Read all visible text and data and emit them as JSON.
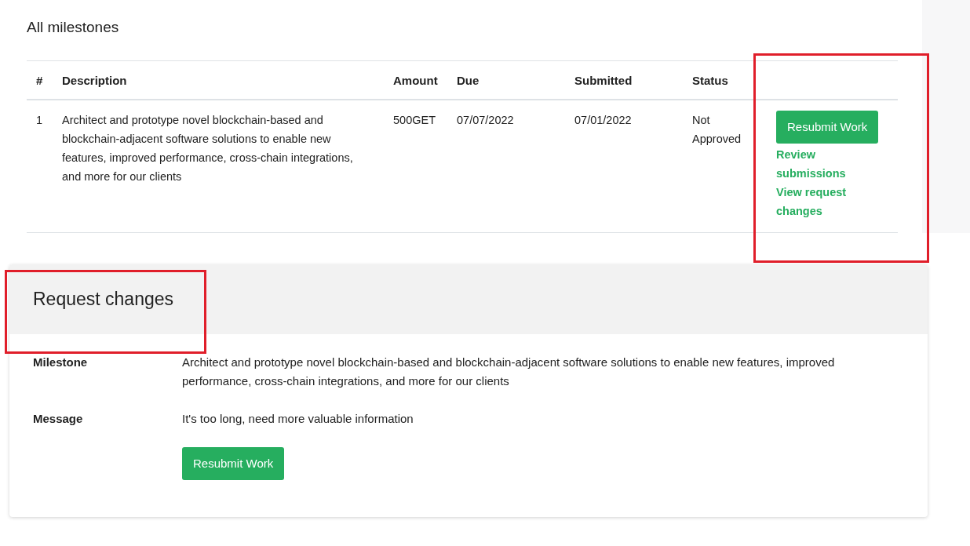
{
  "milestones": {
    "title": "All milestones",
    "columns": [
      "#",
      "Description",
      "Amount",
      "Due",
      "Submitted",
      "Status"
    ],
    "rows": [
      {
        "cells": [
          "1",
          "Architect and prototype novel blockchain-based and blockchain-adjacent software solutions to enable new features, improved performance, cross-chain integrations, and more for our clients",
          "500GET",
          "07/07/2022",
          "07/01/2022",
          "Not Approved"
        ],
        "button": "Resubmit Work",
        "links": [
          "Review submissions",
          "View request changes"
        ]
      }
    ]
  },
  "request_changes": {
    "title": "Request changes",
    "fields": [
      {
        "label": "Milestone",
        "value": "Architect and prototype novel blockchain-based and blockchain-adjacent software solutions to enable new features, improved performance, cross-chain integrations, and more for our clients"
      },
      {
        "label": "Message",
        "value": "It's too long, need more valuable information"
      }
    ],
    "button": "Resubmit Work"
  }
}
